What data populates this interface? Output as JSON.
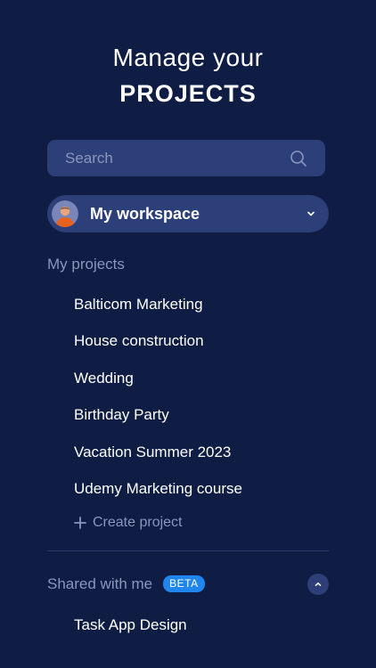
{
  "header": {
    "line1": "Manage your",
    "line2": "PROJECTS"
  },
  "search": {
    "placeholder": "Search",
    "icon": "search-icon"
  },
  "workspace": {
    "name": "My workspace",
    "avatar_icon": "avatar",
    "dropdown_icon": "chevron-down-icon"
  },
  "my_projects": {
    "title": "My projects",
    "items": [
      {
        "label": "Balticom Marketing"
      },
      {
        "label": "House construction"
      },
      {
        "label": "Wedding"
      },
      {
        "label": "Birthday Party"
      },
      {
        "label": "Vacation Summer 2023"
      },
      {
        "label": "Udemy Marketing course"
      }
    ],
    "create_label": "Create project"
  },
  "shared": {
    "title": "Shared with me",
    "badge": "BETA",
    "items": [
      {
        "label": "Task App Design"
      }
    ]
  },
  "colors": {
    "background": "#0f1d44",
    "panel": "#2c3f78",
    "muted_text": "#8b96bb",
    "accent": "#1f86f0"
  }
}
